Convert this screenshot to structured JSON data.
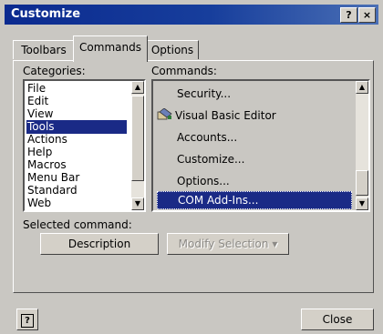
{
  "window": {
    "title": "Customize",
    "help_button": "?",
    "close_button": "×"
  },
  "tabs": [
    {
      "label": "Toolbars"
    },
    {
      "label": "Commands"
    },
    {
      "label": "Options"
    }
  ],
  "categories": {
    "label": "Categories:",
    "items": [
      "File",
      "Edit",
      "View",
      "Tools",
      "Actions",
      "Help",
      "Macros",
      "Menu Bar",
      "Standard",
      "Web"
    ],
    "selected": "Tools"
  },
  "commands": {
    "label": "Commands:",
    "items": [
      "Security...",
      "Visual Basic Editor",
      "Accounts...",
      "Customize...",
      "Options...",
      "COM Add-Ins..."
    ],
    "selected": "COM Add-Ins..."
  },
  "selected_command": {
    "label": "Selected command:",
    "description_button": "Description",
    "modify_button": "Modify Selection",
    "modify_arrow": "▾"
  },
  "footer": {
    "help_glyph": "?",
    "close_button": "Close"
  },
  "colors": {
    "titlebar": "#0b2a8f",
    "selection": "#1a2a86",
    "dialog": "#c9c7c2"
  },
  "icons": {
    "vb_editor": "visual-basic-editor-icon"
  }
}
